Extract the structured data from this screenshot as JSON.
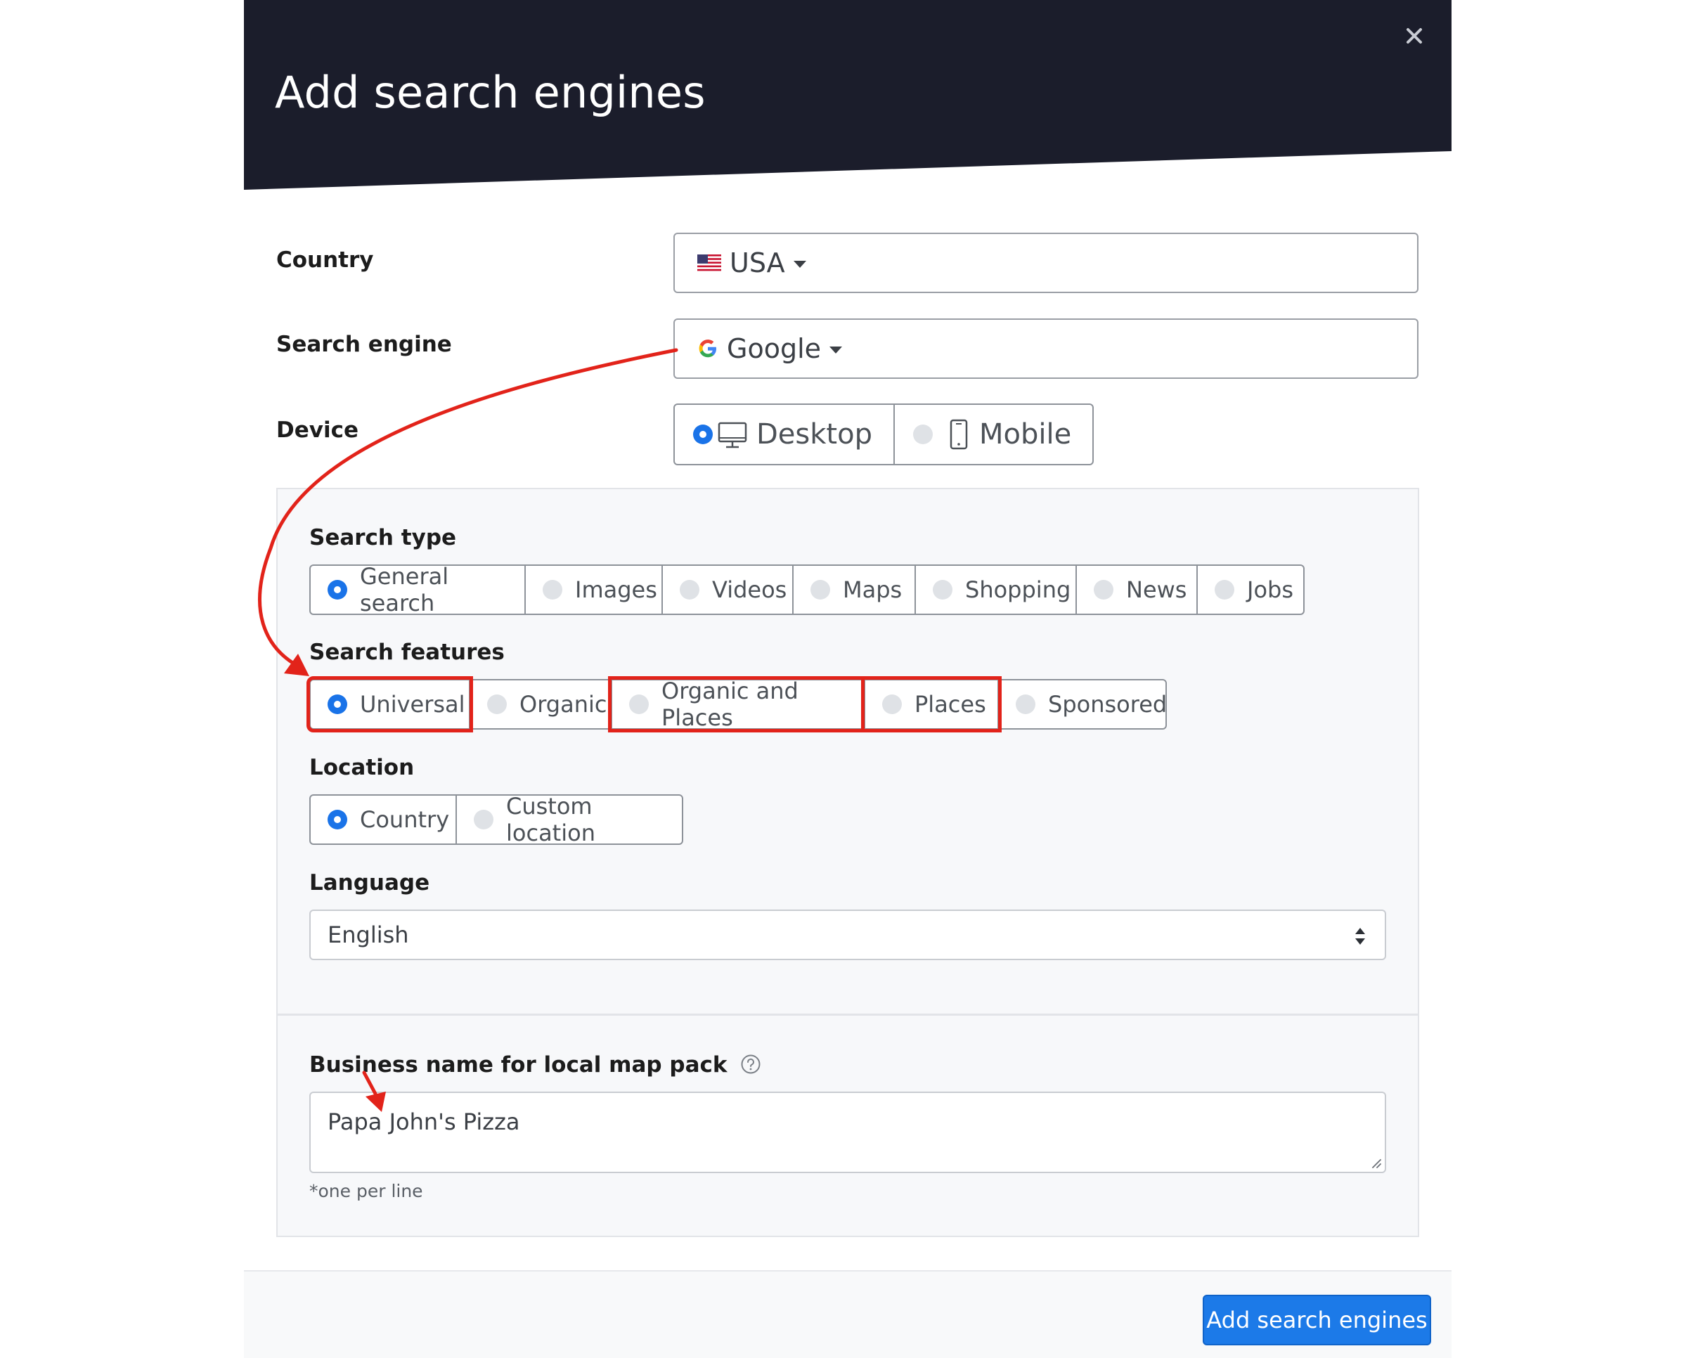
{
  "modal": {
    "title": "Add search engines",
    "close_icon": "close-icon"
  },
  "country": {
    "label": "Country",
    "value": "USA",
    "flag_icon": "us-flag-icon"
  },
  "search_engine": {
    "label": "Search engine",
    "value": "Google",
    "logo_icon": "google-g-icon"
  },
  "device": {
    "label": "Device",
    "options": [
      {
        "label": "Desktop",
        "icon": "desktop-icon",
        "selected": true
      },
      {
        "label": "Mobile",
        "icon": "mobile-icon",
        "selected": false
      }
    ]
  },
  "search_type": {
    "label": "Search type",
    "options": [
      {
        "label": "General search",
        "selected": true
      },
      {
        "label": "Images",
        "selected": false
      },
      {
        "label": "Videos",
        "selected": false
      },
      {
        "label": "Maps",
        "selected": false
      },
      {
        "label": "Shopping",
        "selected": false
      },
      {
        "label": "News",
        "selected": false
      },
      {
        "label": "Jobs",
        "selected": false
      }
    ]
  },
  "search_features": {
    "label": "Search features",
    "options": [
      {
        "label": "Universal",
        "selected": true,
        "highlighted": true
      },
      {
        "label": "Organic",
        "selected": false,
        "highlighted": false
      },
      {
        "label": "Organic and Places",
        "selected": false,
        "highlighted": true
      },
      {
        "label": "Places",
        "selected": false,
        "highlighted": true
      },
      {
        "label": "Sponsored",
        "selected": false,
        "highlighted": false
      }
    ]
  },
  "location": {
    "label": "Location",
    "options": [
      {
        "label": "Country",
        "selected": true
      },
      {
        "label": "Custom location",
        "selected": false
      }
    ]
  },
  "language": {
    "label": "Language",
    "value": "English"
  },
  "business": {
    "label": "Business name for local map pack",
    "help_icon": "help-circle-icon",
    "value": "Papa John's Pizza",
    "hint": "*one per line"
  },
  "footer": {
    "submit_label": "Add search engines"
  },
  "annotations": {
    "color": "#e2231a"
  }
}
